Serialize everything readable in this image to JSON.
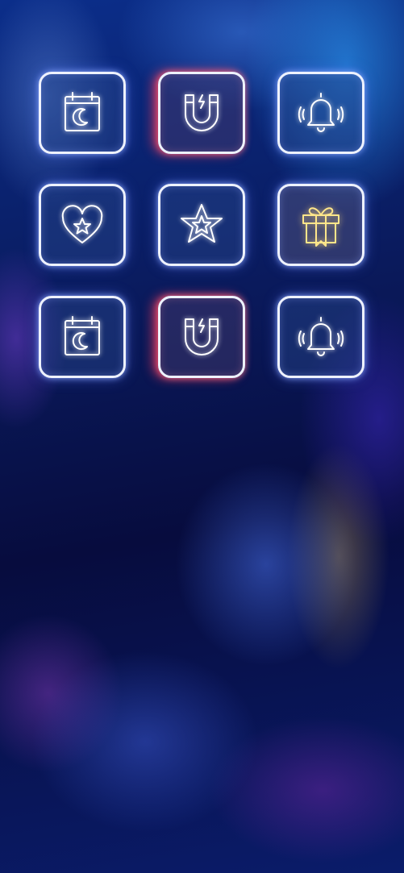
{
  "wallpaper": {
    "description_colors": [
      "#08103e",
      "#0b2e8a",
      "#2a8ce6",
      "#6e3cc8"
    ]
  },
  "app_grid": [
    {
      "row": 1,
      "col": 1,
      "icon": "calendar-moon-icon",
      "glow": "#aab8ff"
    },
    {
      "row": 1,
      "col": 2,
      "icon": "magnet-icon",
      "glow": "#ff3c5a"
    },
    {
      "row": 1,
      "col": 3,
      "icon": "bell-ringing-icon",
      "glow": "#aab8ff"
    },
    {
      "row": 2,
      "col": 1,
      "icon": "heart-star-icon",
      "glow": "#aab8ff"
    },
    {
      "row": 2,
      "col": 2,
      "icon": "star-icon",
      "glow": "#aab8ff"
    },
    {
      "row": 2,
      "col": 3,
      "icon": "gift-icon",
      "glow": "#ffe68a"
    },
    {
      "row": 3,
      "col": 1,
      "icon": "calendar-moon-icon",
      "glow": "#aab8ff"
    },
    {
      "row": 3,
      "col": 2,
      "icon": "magnet-icon",
      "glow": "#ff3c5a"
    },
    {
      "row": 3,
      "col": 3,
      "icon": "bell-ringing-icon",
      "glow": "#aab8ff"
    }
  ],
  "colors": {
    "tile_border": "#eef2ff",
    "icon_stroke": "#ffffff",
    "gift_stroke": "#ffe68a",
    "magnet_glow": "#ff3c5a"
  }
}
